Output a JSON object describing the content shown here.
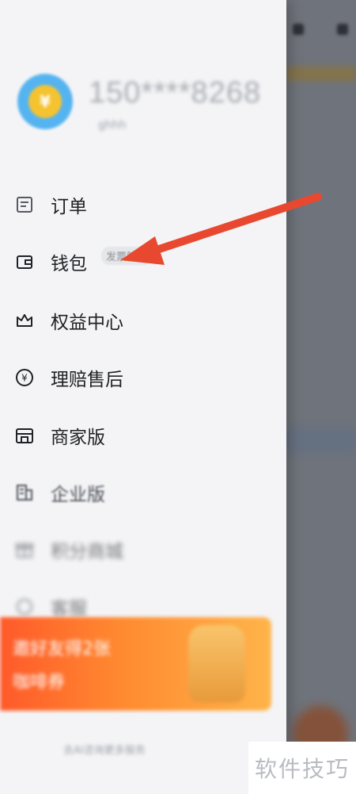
{
  "profile": {
    "avatar_icon": "gold-coin-avatar-icon",
    "phone": "150****8268",
    "subtitle": "ghhh"
  },
  "menu": [
    {
      "label": "订单",
      "icon": "order-list-icon"
    },
    {
      "label": "钱包",
      "icon": "wallet-icon",
      "badge": "发票管理"
    },
    {
      "label": "权益中心",
      "icon": "crown-icon"
    },
    {
      "label": "理赔售后",
      "icon": "yuan-circle-icon"
    },
    {
      "label": "商家版",
      "icon": "store-icon"
    },
    {
      "label": "企业版",
      "icon": "building-icon"
    },
    {
      "label": "积分商城",
      "icon": "gift-icon"
    },
    {
      "label": "客服",
      "icon": "headset-icon"
    }
  ],
  "banner": {
    "line1": "邀好友得2张",
    "line2": "咖啡券"
  },
  "footer": {
    "text": "去AI咨询更多服务"
  },
  "watermark": {
    "text": "软件技巧"
  },
  "colors": {
    "accent_orange": "#ff6a2a",
    "arrow_red": "#e8482f",
    "drawer_bg": "#f4f4f6"
  }
}
